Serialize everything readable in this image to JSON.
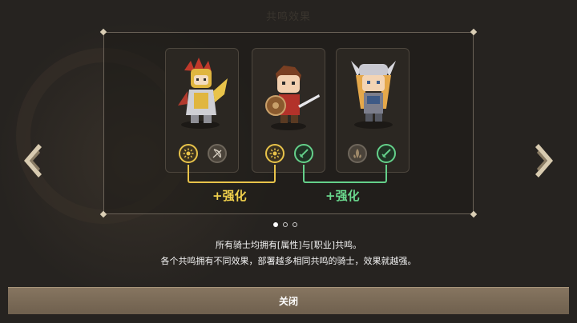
{
  "header": {
    "title": "共鸣效果"
  },
  "heroes": [
    {
      "name": "dragon-knight",
      "element_icon": "sun-icon",
      "element_state": "active",
      "class_icon": "bow-icon",
      "class_state": "inactive"
    },
    {
      "name": "young-warrior",
      "element_icon": "sun-icon",
      "element_state": "active",
      "class_icon": "sword-icon",
      "class_state": "active"
    },
    {
      "name": "valkyrie",
      "element_icon": "earth-icon",
      "element_state": "inactive",
      "class_icon": "sword-icon",
      "class_state": "active"
    }
  ],
  "bonuses": {
    "attribute_label": "+强化",
    "class_label": "+强化",
    "attribute_color": "#f0d04c",
    "class_color": "#6ad88e"
  },
  "pagination": {
    "total": 3,
    "current": 1
  },
  "description": {
    "line1": "所有骑士均拥有[属性]与[职业]共鸣。",
    "line2": "各个共鸣拥有不同效果，部署越多相同共鸣的骑士，效果就越强。"
  },
  "footer": {
    "close_label": "关闭"
  }
}
